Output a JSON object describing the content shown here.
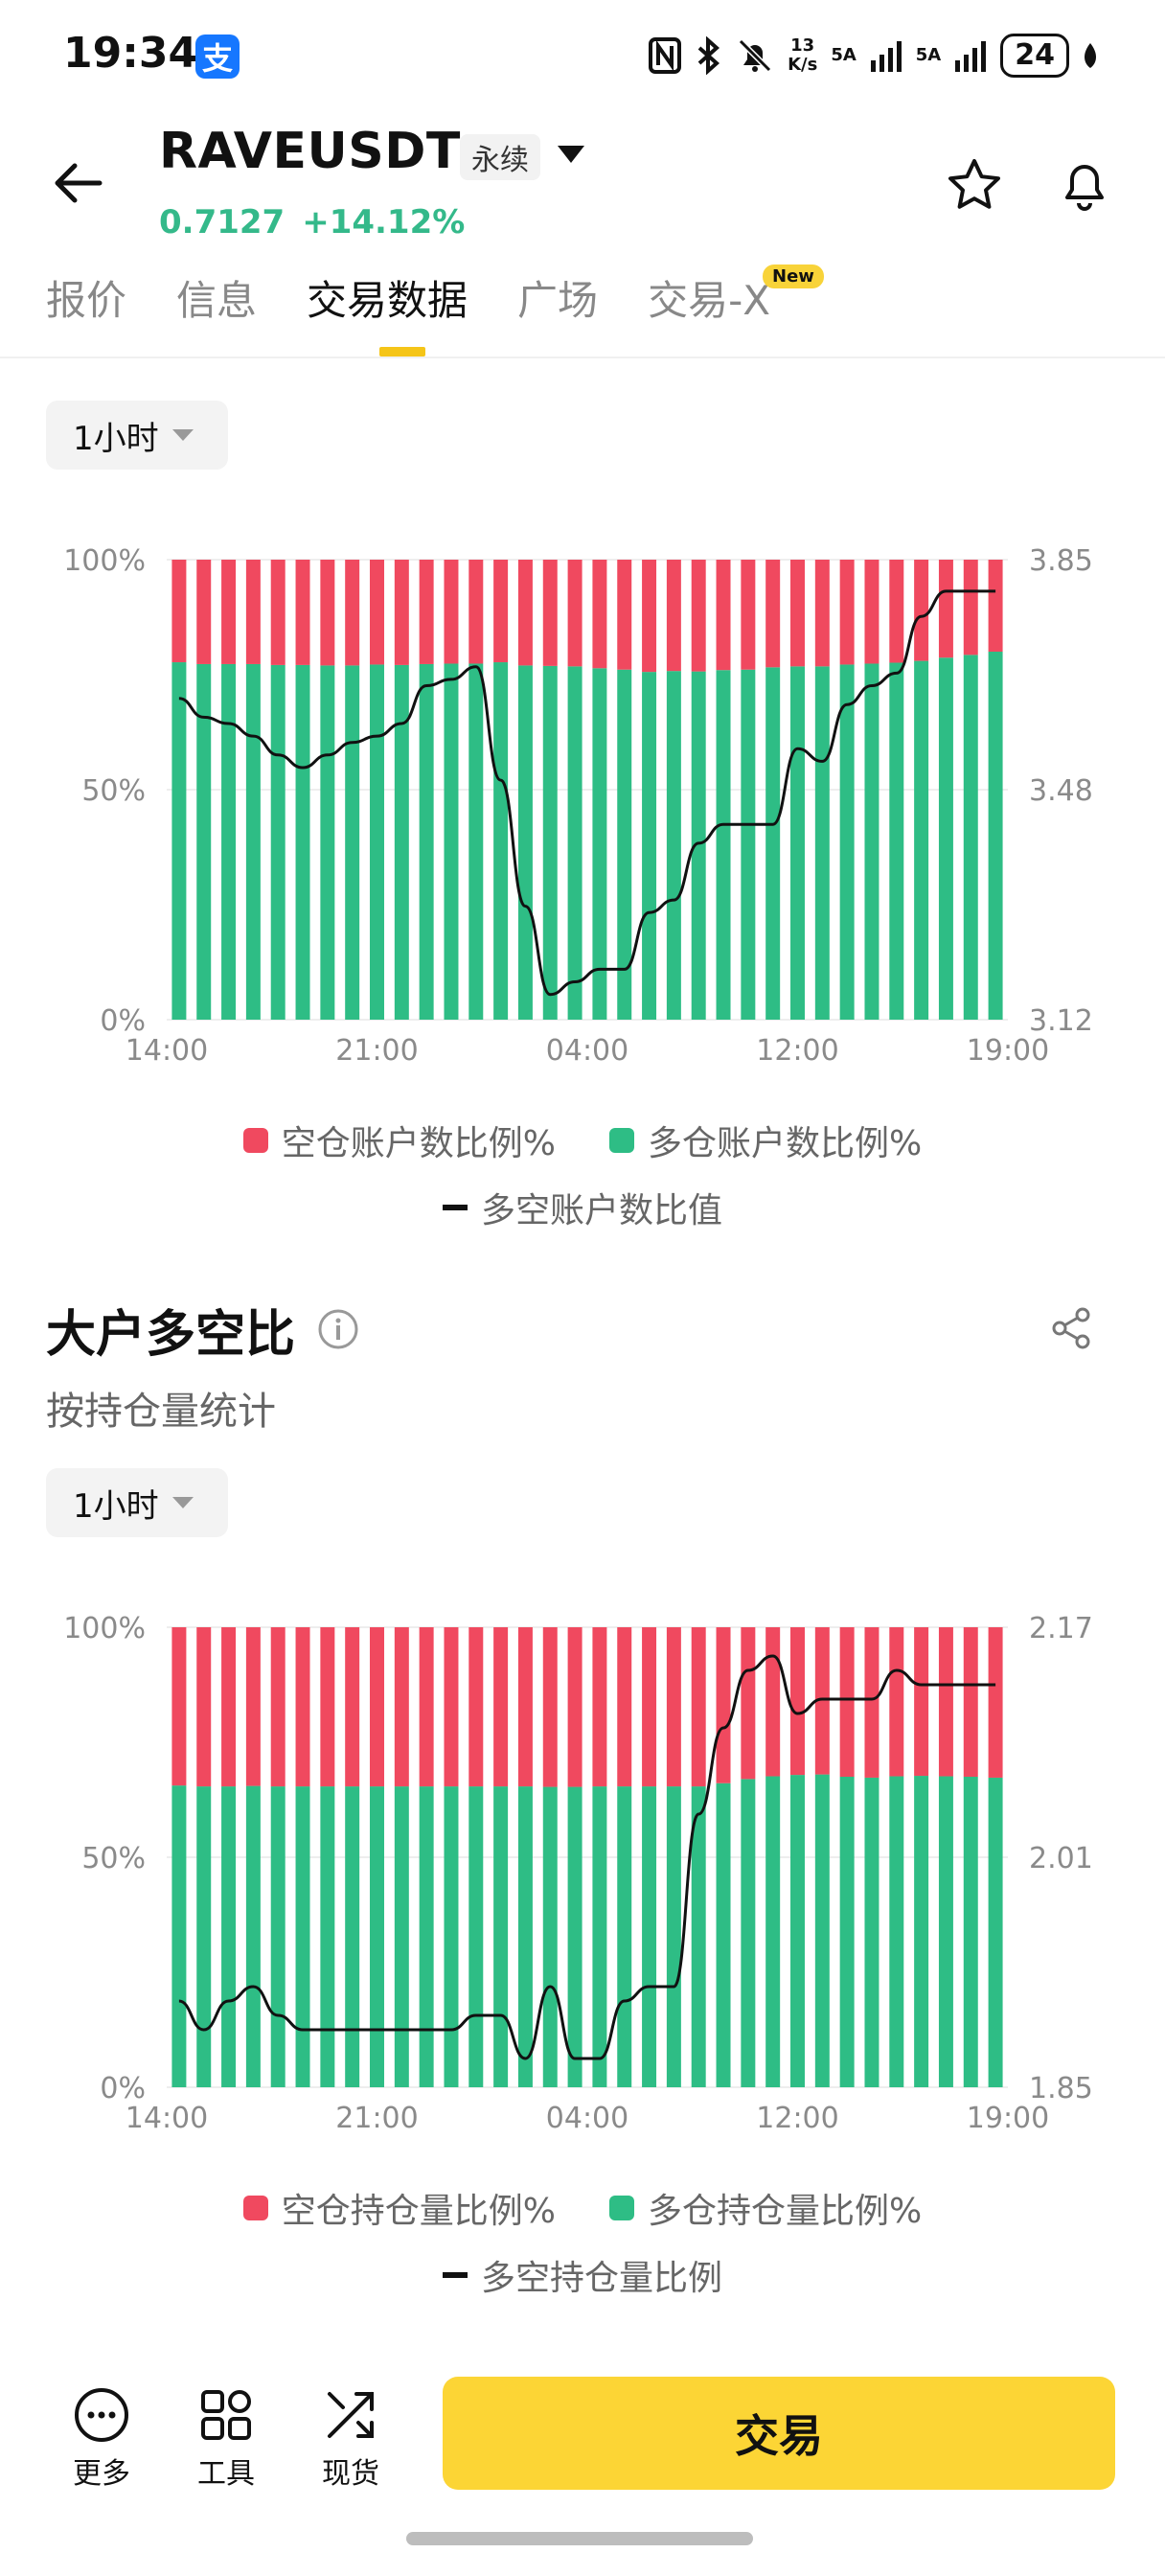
{
  "status_bar": {
    "time": "19:34",
    "alipay_glyph": "支",
    "net_speed_value": "13",
    "net_speed_unit": "K/s",
    "signal1": "5A",
    "signal2": "5A",
    "battery": "24"
  },
  "header": {
    "symbol": "RAVEUSDT",
    "contract_type": "永续",
    "price": "0.7127",
    "change": "+14.12%"
  },
  "tabs": [
    {
      "label": "报价"
    },
    {
      "label": "信息"
    },
    {
      "label": "交易数据"
    },
    {
      "label": "广场"
    },
    {
      "label": "交易-X"
    }
  ],
  "new_badge": "New",
  "colors": {
    "short": "#f0495f",
    "long": "#2ebd85",
    "ratio_line": "#111111",
    "accent": "#fcd535"
  },
  "chart1": {
    "period": "1小时",
    "legend_short": "空仓账户数比例%",
    "legend_long": "多仓账户数比例%",
    "legend_ratio": "多空账户数比值"
  },
  "section2": {
    "title": "大户多空比",
    "subtitle": "按持仓量统计"
  },
  "chart2": {
    "period": "1小时",
    "legend_short": "空仓持仓量比例%",
    "legend_long": "多仓持仓量比例%",
    "legend_ratio": "多空持仓量比例"
  },
  "chart_data": [
    {
      "type": "bar",
      "x_ticks": [
        "14:00",
        "21:00",
        "04:00",
        "12:00",
        "19:00"
      ],
      "left_axis_ticks": [
        "100%",
        "50%",
        "0%"
      ],
      "right_axis_ticks": [
        "3.85",
        "3.48",
        "3.12"
      ],
      "ylim_right": [
        3.12,
        3.85
      ],
      "series": [
        {
          "name": "空仓账户数比例%",
          "values": [
            22.3,
            22.7,
            22.7,
            22.7,
            22.9,
            22.9,
            23.0,
            23.0,
            22.8,
            22.9,
            22.7,
            22.6,
            22.6,
            22.3,
            23.0,
            23.1,
            23.2,
            23.6,
            23.9,
            24.4,
            24.2,
            24.3,
            24.0,
            23.9,
            23.4,
            23.2,
            23.2,
            22.8,
            22.6,
            22.4,
            22.0,
            21.3,
            20.7,
            20.0
          ]
        },
        {
          "name": "多仓账户数比例%",
          "values": [
            77.7,
            77.3,
            77.3,
            77.3,
            77.1,
            77.1,
            77.0,
            77.0,
            77.2,
            77.1,
            77.3,
            77.4,
            77.4,
            77.7,
            77.0,
            76.9,
            76.8,
            76.4,
            76.1,
            75.6,
            75.8,
            75.7,
            76.0,
            76.1,
            76.6,
            76.8,
            76.8,
            77.2,
            77.4,
            77.6,
            78.0,
            78.7,
            79.3,
            80.0
          ]
        },
        {
          "name": "多空账户数比值",
          "values": [
            3.63,
            3.6,
            3.59,
            3.57,
            3.54,
            3.52,
            3.54,
            3.56,
            3.57,
            3.59,
            3.65,
            3.66,
            3.68,
            3.5,
            3.3,
            3.16,
            3.18,
            3.2,
            3.2,
            3.29,
            3.31,
            3.4,
            3.43,
            3.43,
            3.43,
            3.55,
            3.53,
            3.62,
            3.65,
            3.67,
            3.76,
            3.8,
            3.8,
            3.8
          ]
        }
      ]
    },
    {
      "type": "bar",
      "x_ticks": [
        "14:00",
        "21:00",
        "04:00",
        "12:00",
        "19:00"
      ],
      "left_axis_ticks": [
        "100%",
        "50%",
        "0%"
      ],
      "right_axis_ticks": [
        "2.17",
        "2.01",
        "1.85"
      ],
      "ylim_right": [
        1.85,
        2.17
      ],
      "series": [
        {
          "name": "空仓持仓量比例%",
          "values": [
            34.4,
            34.6,
            34.6,
            34.5,
            34.6,
            34.6,
            34.6,
            34.6,
            34.6,
            34.6,
            34.6,
            34.6,
            34.6,
            34.6,
            34.6,
            34.7,
            34.7,
            34.6,
            34.6,
            34.6,
            34.6,
            34.6,
            33.9,
            33.0,
            32.4,
            32.1,
            32.0,
            32.5,
            32.7,
            32.4,
            32.3,
            32.4,
            32.5,
            32.7
          ]
        },
        {
          "name": "多仓持仓量比例%",
          "values": [
            65.6,
            65.4,
            65.4,
            65.5,
            65.4,
            65.4,
            65.4,
            65.4,
            65.4,
            65.4,
            65.4,
            65.4,
            65.4,
            65.4,
            65.4,
            65.3,
            65.3,
            65.4,
            65.4,
            65.4,
            65.4,
            65.4,
            66.1,
            67.0,
            67.6,
            67.9,
            68.0,
            67.5,
            67.3,
            67.6,
            67.7,
            67.6,
            67.5,
            67.3
          ]
        },
        {
          "name": "多空持仓量比例",
          "values": [
            1.91,
            1.89,
            1.91,
            1.92,
            1.9,
            1.89,
            1.89,
            1.89,
            1.89,
            1.89,
            1.89,
            1.89,
            1.9,
            1.9,
            1.87,
            1.92,
            1.87,
            1.87,
            1.91,
            1.92,
            1.92,
            2.04,
            2.1,
            2.14,
            2.15,
            2.11,
            2.12,
            2.12,
            2.12,
            2.14,
            2.13,
            2.13,
            2.13,
            2.13
          ]
        }
      ]
    }
  ],
  "bottom_bar": {
    "more_label": "更多",
    "tools_label": "工具",
    "spot_label": "现货",
    "trade_label": "交易"
  }
}
